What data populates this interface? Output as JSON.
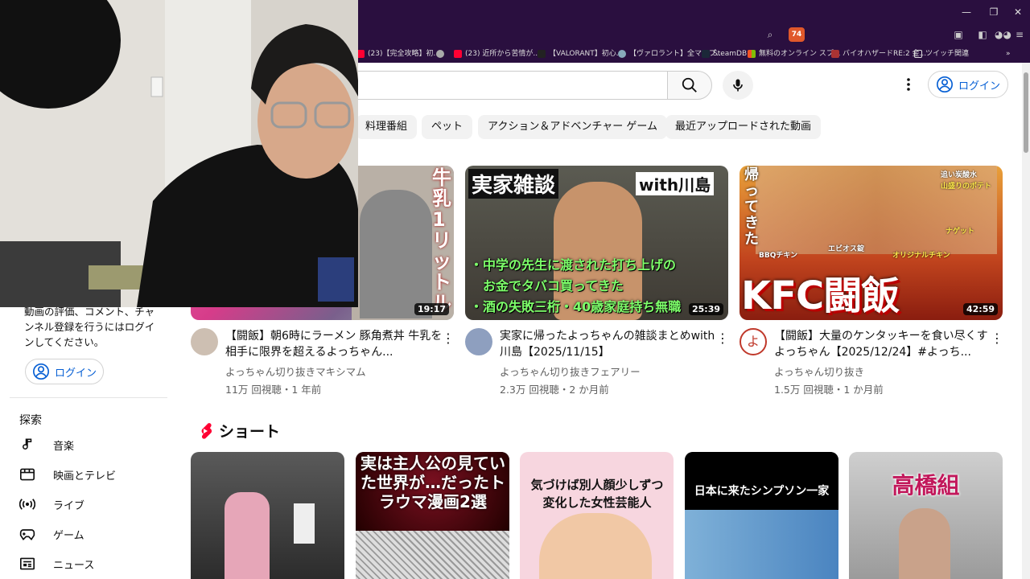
{
  "colors": {
    "brand_red": "#ff0033",
    "link_blue": "#065fd4",
    "chrome_purple": "#2a0f3f"
  },
  "browser": {
    "shield_badge": "74",
    "bookmarks": [
      {
        "label": "(23)【完全攻略】初...",
        "icon": "youtube-icon"
      },
      {
        "label": "",
        "icon": "globe-icon"
      },
      {
        "label": "(23) 近所から苦情が...",
        "icon": "youtube-icon"
      },
      {
        "label": "【VALORANT】初心...",
        "icon": "valorant-icon"
      },
      {
        "label": "【ヴァロラント】全マップ...",
        "icon": "site-icon"
      },
      {
        "label": "SteamDB",
        "icon": "steam-icon"
      },
      {
        "label": "無料のオンライン スプ...",
        "icon": "microsoft-icon"
      },
      {
        "label": "バイオハザードRE:2 金...",
        "icon": "site-icon"
      },
      {
        "label": "ツイッチ関連",
        "icon": "folder-icon"
      }
    ]
  },
  "header": {
    "login_label": "ログイン"
  },
  "chips": [
    "料理番組",
    "ペット",
    "アクション＆アドベンチャー ゲーム",
    "最近アップロードされた動画"
  ],
  "videos": [
    {
      "title": "【闘飯】朝6時にラーメン 豚角煮丼 牛乳を相手に限界を超えるよっちゃん...",
      "channel": "よっちゃん切り抜きマキシマム",
      "meta": "11万 回視聴・1 年前",
      "duration": "19:17",
      "thumb_text": [
        "牛乳1リットル"
      ]
    },
    {
      "title": "実家に帰ったよっちゃんの雑談まとめwith川島【2025/11/15】",
      "channel": "よっちゃん切り抜きフェアリー",
      "meta": "2.3万 回視聴・2 か月前",
      "duration": "25:39",
      "thumb_text": [
        "実家雑談",
        "with川島",
        "・中学の先生に渡された打ち上げの",
        "お金でタバコ買ってきた",
        "・酒の失敗三桁・40歳家庭持ち無職"
      ]
    },
    {
      "title": "【闘飯】大量のケンタッキーを食い尽くすよっちゃん【2025/12/24】#よっち...",
      "channel": "よっちゃん切り抜き",
      "meta": "1.5万 回視聴・1 か月前",
      "duration": "42:59",
      "thumb_text": [
        "帰ってきた",
        "KFC闘飯",
        "BBQチキン",
        "エビオス錠",
        "オリジナルチキン",
        "ナゲット",
        "追い炭酸水",
        "山盛りのポテト"
      ]
    }
  ],
  "sidebar": {
    "notice": "動画の評価、コメント、チャンネル登録を行うにはログインしてください。",
    "login_label": "ログイン",
    "explore_heading": "探索",
    "items": [
      {
        "label": "音楽",
        "icon": "music-note-icon"
      },
      {
        "label": "映画とテレビ",
        "icon": "film-icon"
      },
      {
        "label": "ライブ",
        "icon": "live-broadcast-icon"
      },
      {
        "label": "ゲーム",
        "icon": "gamepad-icon"
      },
      {
        "label": "ニュース",
        "icon": "newspaper-icon"
      }
    ]
  },
  "shorts": {
    "heading": "ショート",
    "items": [
      {
        "text": ""
      },
      {
        "text": "実は主人公の見ていた世界が…だったトラウマ漫画2選"
      },
      {
        "text": "気づけば別人顔少しずつ変化した女性芸能人"
      },
      {
        "text": "日本に来たシンプソン一家"
      },
      {
        "text": "高橋組"
      }
    ]
  }
}
